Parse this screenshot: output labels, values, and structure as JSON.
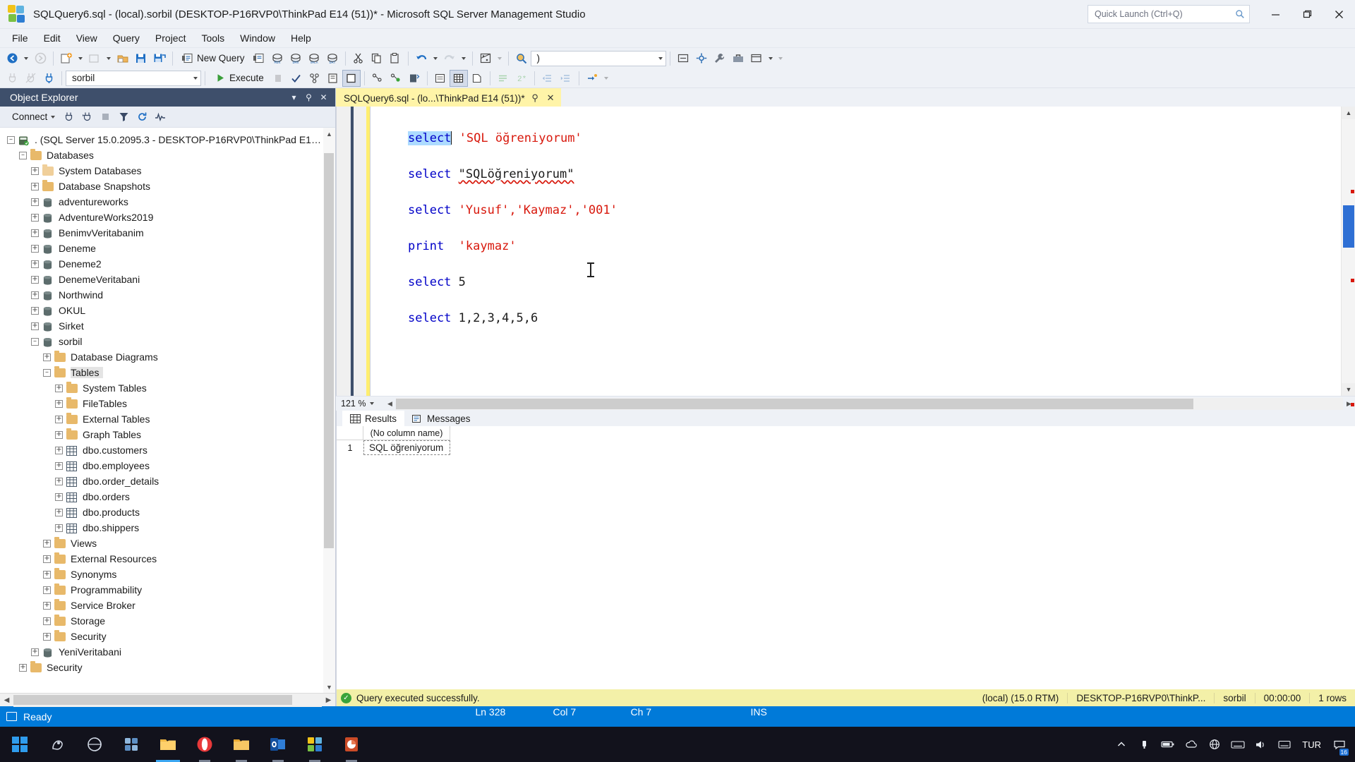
{
  "window": {
    "title": "SQLQuery6.sql - (local).sorbil (DESKTOP-P16RVP0\\ThinkPad E14 (51))* - Microsoft SQL Server Management Studio",
    "quick_launch_placeholder": "Quick Launch (Ctrl+Q)",
    "minimize_label": "Minimize",
    "restore_label": "Restore",
    "close_label": "Close"
  },
  "menu": {
    "items": [
      "File",
      "Edit",
      "View",
      "Query",
      "Project",
      "Tools",
      "Window",
      "Help"
    ]
  },
  "toolbar1": {
    "new_query_label": "New Query",
    "find_value": ")",
    "icons": [
      "navigate-backward-icon",
      "navigate-forward-icon",
      "new-project-icon",
      "open-file-icon",
      "open-folder-icon",
      "save-icon",
      "save-all-icon",
      "new-query-icon",
      "new-query-with-connection-icon",
      "new-analysis-services-mdx-query-icon",
      "new-analysis-services-dmx-query-icon",
      "new-analysis-services-xmla-query-icon",
      "new-data-query-icon",
      "cut-icon",
      "copy-icon",
      "paste-icon",
      "undo-icon",
      "redo-icon",
      "registered-servers-icon",
      "find-in-files-icon"
    ]
  },
  "toolbar2": {
    "database_value": "sorbil",
    "execute_label": "Execute",
    "icons": [
      "connect-icon",
      "disconnect-icon",
      "change-connection-icon",
      "debug-icon",
      "parse-icon",
      "display-estimated-plan-icon",
      "query-options-icon",
      "include-actual-plan-icon",
      "include-client-statistics-icon",
      "include-live-plan-icon",
      "results-to-text-icon",
      "results-to-grid-icon",
      "results-to-file-icon",
      "comment-icon",
      "uncomment-icon",
      "decrease-indent-icon",
      "increase-indent-icon",
      "specify-values-icon"
    ]
  },
  "object_explorer": {
    "title": "Object Explorer",
    "connect_label": "Connect",
    "toolbar_icons": [
      "connect-icon",
      "disconnect-icon",
      "stop-icon",
      "filter-icon",
      "refresh-icon",
      "activity-monitor-icon"
    ],
    "tree": [
      {
        "label": ". (SQL Server 15.0.2095.3 - DESKTOP-P16RVP0\\ThinkPad E1…",
        "depth": 0,
        "state": "minus",
        "icon": "server-icon"
      },
      {
        "label": "Databases",
        "depth": 1,
        "state": "minus",
        "icon": "folder-icon"
      },
      {
        "label": "System Databases",
        "depth": 2,
        "state": "plus",
        "icon": "folder-pale-icon"
      },
      {
        "label": "Database Snapshots",
        "depth": 2,
        "state": "plus",
        "icon": "folder-icon"
      },
      {
        "label": "adventureworks",
        "depth": 2,
        "state": "plus",
        "icon": "database-icon"
      },
      {
        "label": "AdventureWorks2019",
        "depth": 2,
        "state": "plus",
        "icon": "database-icon"
      },
      {
        "label": "BenimvVeritabanim",
        "depth": 2,
        "state": "plus",
        "icon": "database-icon"
      },
      {
        "label": "Deneme",
        "depth": 2,
        "state": "plus",
        "icon": "database-icon"
      },
      {
        "label": "Deneme2",
        "depth": 2,
        "state": "plus",
        "icon": "database-icon"
      },
      {
        "label": "DenemeVeritabani",
        "depth": 2,
        "state": "plus",
        "icon": "database-icon"
      },
      {
        "label": "Northwind",
        "depth": 2,
        "state": "plus",
        "icon": "database-icon"
      },
      {
        "label": "OKUL",
        "depth": 2,
        "state": "plus",
        "icon": "database-icon"
      },
      {
        "label": "Sirket",
        "depth": 2,
        "state": "plus",
        "icon": "database-icon"
      },
      {
        "label": "sorbil",
        "depth": 2,
        "state": "minus",
        "icon": "database-icon"
      },
      {
        "label": "Database Diagrams",
        "depth": 3,
        "state": "plus",
        "icon": "folder-icon"
      },
      {
        "label": "Tables",
        "depth": 3,
        "state": "minus",
        "icon": "folder-icon",
        "selected": true
      },
      {
        "label": "System Tables",
        "depth": 4,
        "state": "plus",
        "icon": "folder-icon"
      },
      {
        "label": "FileTables",
        "depth": 4,
        "state": "plus",
        "icon": "folder-icon"
      },
      {
        "label": "External Tables",
        "depth": 4,
        "state": "plus",
        "icon": "folder-icon"
      },
      {
        "label": "Graph Tables",
        "depth": 4,
        "state": "plus",
        "icon": "folder-icon"
      },
      {
        "label": "dbo.customers",
        "depth": 4,
        "state": "plus",
        "icon": "table-icon"
      },
      {
        "label": "dbo.employees",
        "depth": 4,
        "state": "plus",
        "icon": "table-icon"
      },
      {
        "label": "dbo.order_details",
        "depth": 4,
        "state": "plus",
        "icon": "table-icon"
      },
      {
        "label": "dbo.orders",
        "depth": 4,
        "state": "plus",
        "icon": "table-icon"
      },
      {
        "label": "dbo.products",
        "depth": 4,
        "state": "plus",
        "icon": "table-icon"
      },
      {
        "label": "dbo.shippers",
        "depth": 4,
        "state": "plus",
        "icon": "table-icon"
      },
      {
        "label": "Views",
        "depth": 3,
        "state": "plus",
        "icon": "folder-icon"
      },
      {
        "label": "External Resources",
        "depth": 3,
        "state": "plus",
        "icon": "folder-icon"
      },
      {
        "label": "Synonyms",
        "depth": 3,
        "state": "plus",
        "icon": "folder-icon"
      },
      {
        "label": "Programmability",
        "depth": 3,
        "state": "plus",
        "icon": "folder-icon"
      },
      {
        "label": "Service Broker",
        "depth": 3,
        "state": "plus",
        "icon": "folder-icon"
      },
      {
        "label": "Storage",
        "depth": 3,
        "state": "plus",
        "icon": "folder-icon"
      },
      {
        "label": "Security",
        "depth": 3,
        "state": "plus",
        "icon": "folder-icon"
      },
      {
        "label": "YeniVeritabani",
        "depth": 2,
        "state": "plus",
        "icon": "database-icon"
      },
      {
        "label": "Security",
        "depth": 1,
        "state": "plus",
        "icon": "folder-icon"
      }
    ]
  },
  "editor": {
    "tab_label": "SQLQuery6.sql - (lo...\\ThinkPad E14 (51))*",
    "tab_pin_icon": "pin-icon",
    "tab_close_icon": "close-icon",
    "zoom_level": "121 %",
    "lines": [
      {
        "segs": [
          {
            "t": "select",
            "c": "kw selected"
          },
          {
            "t": " ",
            "c": "plain"
          },
          {
            "t": "'SQL öğreniyorum'",
            "c": "str"
          }
        ]
      },
      {
        "segs": [
          {
            "t": "select",
            "c": "kw"
          },
          {
            "t": " ",
            "c": "plain"
          },
          {
            "t": "\"SQLöğreniyorum\"",
            "c": "plain squiggle"
          }
        ]
      },
      {
        "segs": [
          {
            "t": "select",
            "c": "kw"
          },
          {
            "t": " ",
            "c": "plain"
          },
          {
            "t": "'Yusuf','Kaymaz','001'",
            "c": "str"
          }
        ]
      },
      {
        "segs": [
          {
            "t": "print",
            "c": "kw"
          },
          {
            "t": "  ",
            "c": "plain"
          },
          {
            "t": "'kaymaz'",
            "c": "str"
          }
        ]
      },
      {
        "segs": [
          {
            "t": "select",
            "c": "kw"
          },
          {
            "t": " ",
            "c": "plain"
          },
          {
            "t": "5",
            "c": "num"
          }
        ]
      },
      {
        "segs": [
          {
            "t": "select",
            "c": "kw"
          },
          {
            "t": " ",
            "c": "plain"
          },
          {
            "t": "1,2,3,4,5,6",
            "c": "num"
          }
        ]
      }
    ]
  },
  "results": {
    "tabs": [
      {
        "label": "Results",
        "icon": "grid-icon",
        "active": true
      },
      {
        "label": "Messages",
        "icon": "messages-icon",
        "active": false
      }
    ],
    "columns": [
      "(No column name)"
    ],
    "rows": [
      {
        "num": "1",
        "cells": [
          "SQL öğreniyorum"
        ]
      }
    ]
  },
  "query_status": {
    "message": "Query executed successfully.",
    "status_icon": "success-icon",
    "server": "(local) (15.0 RTM)",
    "user": "DESKTOP-P16RVP0\\ThinkP...",
    "database": "sorbil",
    "elapsed": "00:00:00",
    "rows": "1 rows"
  },
  "win_status": {
    "ready": "Ready",
    "ready_icon": "window-icon",
    "line": "Ln 328",
    "col": "Col 7",
    "ch": "Ch 7",
    "ins": "INS"
  },
  "taskbar": {
    "start_icon": "windows-start-icon",
    "apps": [
      {
        "name": "search-icon",
        "state": "pinned"
      },
      {
        "name": "task-view-icon",
        "state": "pinned"
      },
      {
        "name": "widgets-icon",
        "state": "pinned"
      },
      {
        "name": "file-explorer-icon",
        "state": "active"
      },
      {
        "name": "opera-icon",
        "state": "run"
      },
      {
        "name": "folder-icon",
        "state": "run"
      },
      {
        "name": "outlook-icon",
        "state": "run"
      },
      {
        "name": "ssms-icon",
        "state": "run"
      },
      {
        "name": "powerpoint-icon",
        "state": "run"
      }
    ],
    "tray": {
      "show_hidden_icon": "chevron-up-icon",
      "icons": [
        "usb-icon",
        "battery-icon",
        "onedrive-icon",
        "globe-icon",
        "keyboard-layout-icon",
        "volume-icon",
        "input-method-icon"
      ],
      "language": "TUR",
      "notification_badge": "16"
    }
  },
  "colors": {
    "accent_blue": "#007ad9",
    "tab_yellow": "#fff4a8",
    "status_yellow": "#f3f0a8",
    "keyword_blue": "#0000c8",
    "string_red": "#d8180c",
    "oe_header": "#3e4f6b"
  }
}
